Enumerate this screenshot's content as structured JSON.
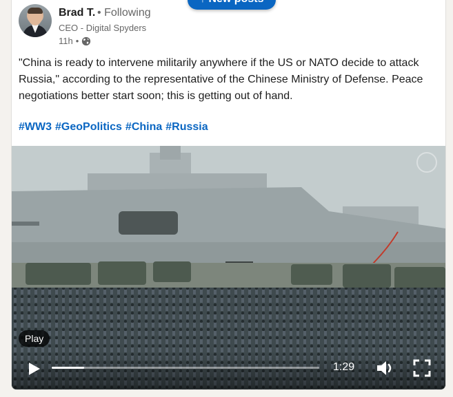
{
  "banner": {
    "new_posts_label": "↑ New posts"
  },
  "post": {
    "author": {
      "name": "Brad T.",
      "separator": "•",
      "follow_status": "Following",
      "headline": "CEO - Digital Spyders",
      "time_ago": "11h",
      "meta_separator": "•",
      "visibility_icon": "globe-icon"
    },
    "text": "\"China is ready to intervene militarily anywhere if the US or NATO decide to attack Russia,\" according to the representative of the Chinese Ministry of Defense. Peace negotiations better start soon; this is getting out of hand.",
    "hashtags": [
      "#WW3",
      "#GeoPolitics",
      "#China",
      "#Russia"
    ]
  },
  "video": {
    "play_badge": "Play",
    "time": "1:29",
    "progress": 0.12,
    "icons": {
      "play": "play-icon",
      "volume": "volume-icon",
      "fullscreen": "fullscreen-icon"
    }
  },
  "colors": {
    "accent": "#0a66c2",
    "text": "#1d1d1d",
    "muted": "#666666"
  }
}
